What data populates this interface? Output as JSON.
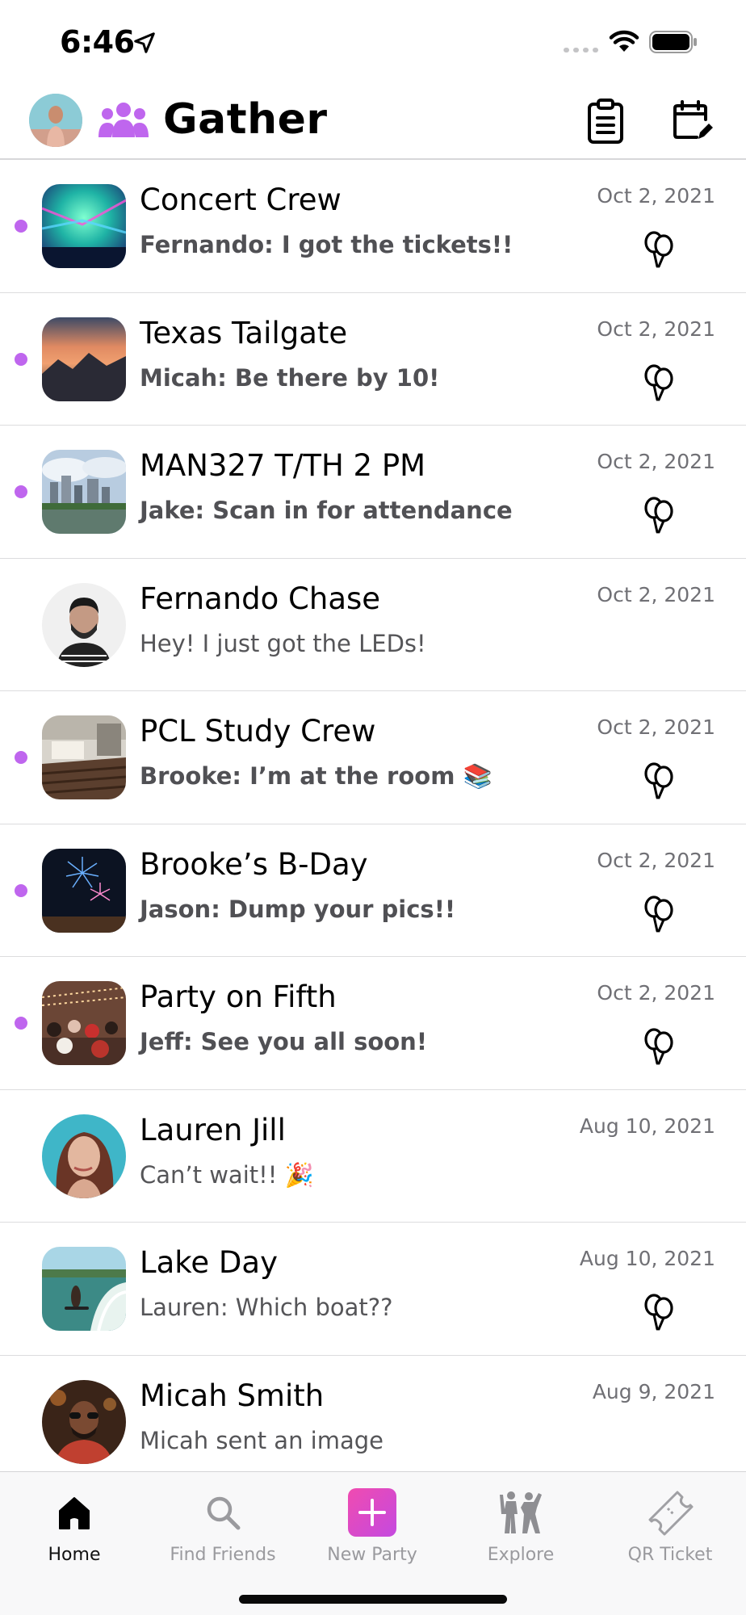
{
  "status_bar": {
    "time": "6:46"
  },
  "header": {
    "title": "Gather"
  },
  "chats": [
    {
      "name": "Concert Crew",
      "message": "Fernando: I got the tickets!!",
      "date": "Oct 2, 2021",
      "unread": true,
      "group": true,
      "avatar": "concert"
    },
    {
      "name": "Texas Tailgate",
      "message": "Micah: Be there by 10!",
      "date": "Oct 2, 2021",
      "unread": true,
      "group": true,
      "avatar": "sunset"
    },
    {
      "name": "MAN327 T/TH 2 PM",
      "message": "Jake: Scan in for attendance",
      "date": "Oct 2, 2021",
      "unread": true,
      "group": true,
      "avatar": "city"
    },
    {
      "name": "Fernando Chase",
      "message": "Hey! I just got the LEDs!",
      "date": "Oct 2, 2021",
      "unread": false,
      "group": false,
      "avatar": "fernando"
    },
    {
      "name": "PCL Study Crew",
      "message": "Brooke: I’m at the room 📚",
      "date": "Oct 2, 2021",
      "unread": true,
      "group": true,
      "avatar": "lecture"
    },
    {
      "name": "Brooke’s B-Day",
      "message": "Jason: Dump your pics!!",
      "date": "Oct 2, 2021",
      "unread": true,
      "group": true,
      "avatar": "fireworks"
    },
    {
      "name": "Party on Fifth",
      "message": "Jeff: See you all soon!",
      "date": "Oct 2, 2021",
      "unread": true,
      "group": true,
      "avatar": "party"
    },
    {
      "name": "Lauren Jill",
      "message": "Can’t wait!! 🎉",
      "date": "Aug 10, 2021",
      "unread": false,
      "group": false,
      "avatar": "lauren"
    },
    {
      "name": "Lake Day",
      "message": "Lauren: Which boat??",
      "date": "Aug 10, 2021",
      "unread": false,
      "group": true,
      "avatar": "lake"
    },
    {
      "name": "Micah Smith",
      "message": "Micah sent an image",
      "date": "Aug 9, 2021",
      "unread": false,
      "group": false,
      "avatar": "micah"
    }
  ],
  "tabs": [
    {
      "label": "Home",
      "icon": "home-icon",
      "active": true
    },
    {
      "label": "Find Friends",
      "icon": "search-icon",
      "active": false
    },
    {
      "label": "New Party",
      "icon": "plus-icon",
      "active": false
    },
    {
      "label": "Explore",
      "icon": "people-dancing-icon",
      "active": false
    },
    {
      "label": "QR Ticket",
      "icon": "ticket-icon",
      "active": false
    }
  ],
  "colors": {
    "accent": "#bf66ee",
    "new_party_gradient_start": "#f04bb0",
    "new_party_gradient_end": "#c44ae0"
  }
}
